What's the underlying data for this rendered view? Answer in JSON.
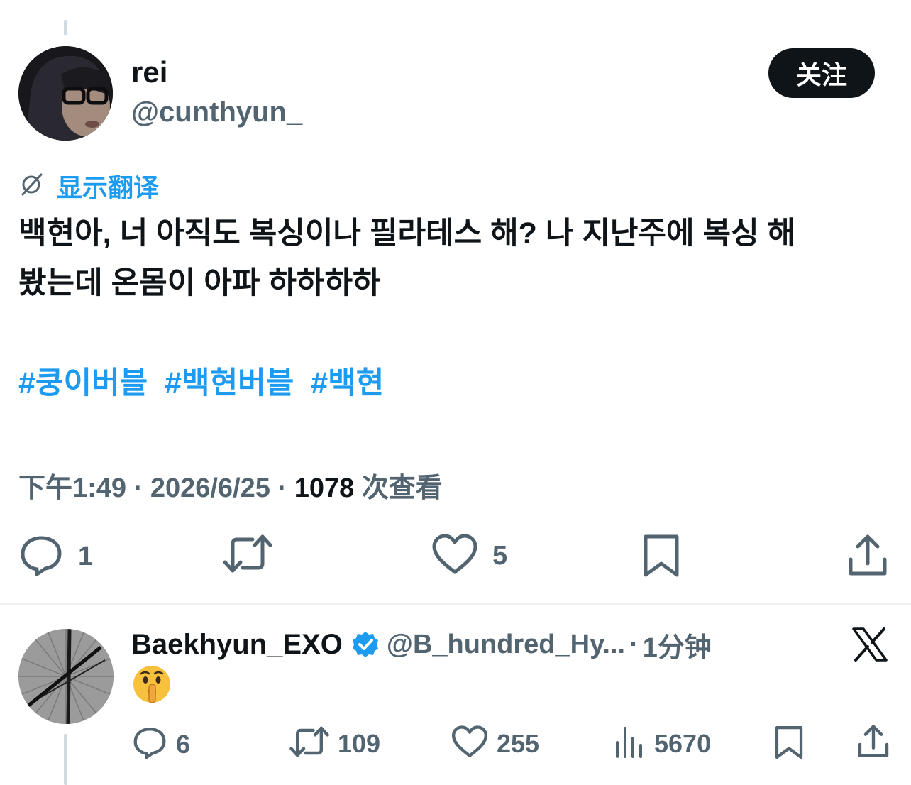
{
  "tweet": {
    "display_name": "rei",
    "handle": "@cunthyun_",
    "follow_label": "关注",
    "translate_label": "显示翻译",
    "text_line1": "백현아, 너 아직도 복싱이나 필라테스 해? 나 지난주에 복싱 해",
    "text_line2": "봤는데 온몸이 아파 하하하하",
    "hashtags": [
      "#쿵이버블",
      "#백현버블",
      "#백현"
    ],
    "time": "下午1:49",
    "date": "2026/6/25",
    "separator": "·",
    "views_count": "1078",
    "views_label": "次查看",
    "actions": {
      "reply_count": "1",
      "like_count": "5"
    }
  },
  "reply": {
    "display_name": "Baekhyun_EXO",
    "handle": "@B_hundred_Hy...",
    "separator": "·",
    "time": "1分钟",
    "emoji": "🤫",
    "actions": {
      "reply_count": "6",
      "retweet_count": "109",
      "like_count": "255",
      "views_count": "5670"
    }
  },
  "colors": {
    "accent": "#1d9bf0",
    "text_primary": "#0f1419",
    "text_secondary": "#536471",
    "button_bg": "#0f1419"
  }
}
